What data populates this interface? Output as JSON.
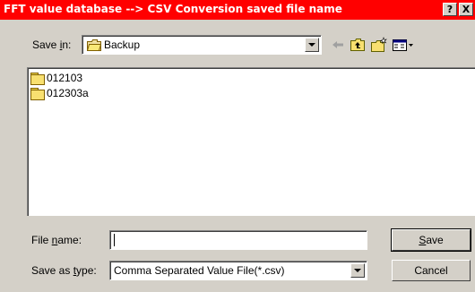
{
  "window": {
    "title": "FFT value database --> CSV Conversion saved file name",
    "help_glyph": "?",
    "close_glyph": "X"
  },
  "save_in": {
    "label_prefix": "Save ",
    "label_underlined": "i",
    "label_suffix": "n:",
    "value": "Backup",
    "icon": "folder-icon"
  },
  "toolbar": {
    "back_icon": "back-arrow-icon",
    "up_icon": "up-one-level-icon",
    "new_folder_icon": "new-folder-icon",
    "view_menu_icon": "view-menu-icon"
  },
  "files": [
    {
      "name": "012103",
      "icon": "folder-icon"
    },
    {
      "name": "012303a",
      "icon": "folder-icon"
    }
  ],
  "file_name": {
    "label_prefix": "File ",
    "label_underlined": "n",
    "label_suffix": "ame:",
    "value": ""
  },
  "save_as_type": {
    "label_prefix": "Save as ",
    "label_underlined": "t",
    "label_suffix": "ype:",
    "value": "Comma Separated Value File(*.csv)"
  },
  "buttons": {
    "save_underlined": "S",
    "save_rest": "ave",
    "cancel": "Cancel"
  },
  "colors": {
    "titlebar": "#ff0000",
    "face": "#d4d0c8"
  }
}
